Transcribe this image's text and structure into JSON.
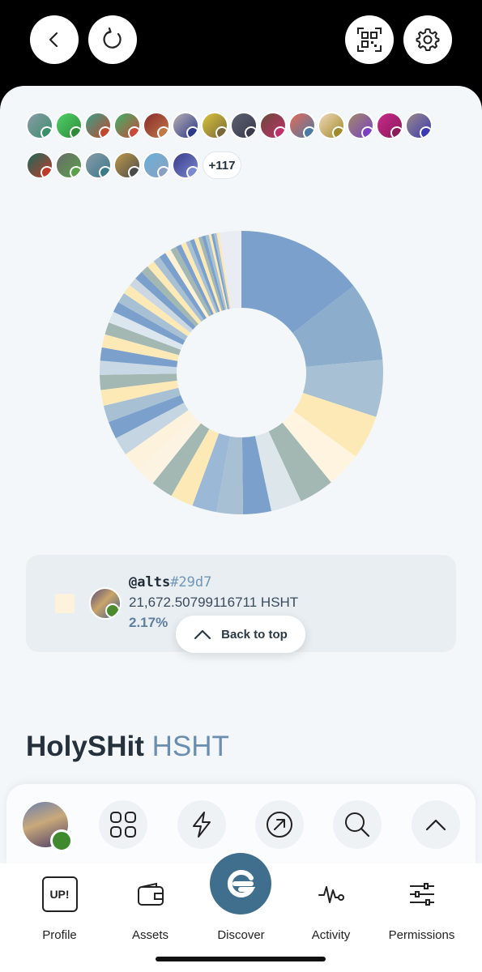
{
  "topbar": {
    "back_icon": "back-icon",
    "refresh_icon": "refresh-icon",
    "qr_icon": "qr-code-icon",
    "settings_icon": "gear-icon"
  },
  "holders": {
    "more_count": "+117"
  },
  "chart_data": {
    "type": "pie",
    "donut": true,
    "title": "",
    "values": [
      14.5,
      9.0,
      6.5,
      5.0,
      4.0,
      4.0,
      3.5,
      3.2,
      3.0,
      2.8,
      2.6,
      2.5,
      2.3,
      2.17,
      2.1,
      2.0,
      1.9,
      1.8,
      1.7,
      1.6,
      1.5,
      1.5,
      1.4,
      1.3,
      1.2,
      1.2,
      1.1,
      1.0,
      1.0,
      0.9,
      0.9,
      0.8,
      0.8,
      0.7,
      0.7,
      0.6,
      0.6,
      0.5,
      0.5,
      0.5,
      0.4,
      0.4,
      0.4,
      0.3,
      0.3,
      0.3,
      0.3,
      2.5
    ],
    "colors": [
      "#7aa0cb",
      "#8cadcb",
      "#a8c0d4",
      "#fde9b5",
      "#fff4e0",
      "#a3b8b3",
      "#dde6ea",
      "#7aa0cb",
      "#a8c0d4",
      "#9bb9d6",
      "#fde9b5",
      "#a3b8b3",
      "#fdf3e3",
      "#fdf3dd",
      "#c5d5e2",
      "#7aa0cb",
      "#a8c0d4",
      "#fde9b5",
      "#a3b8b3",
      "#c8d8e5",
      "#7aa0cb",
      "#fde9b5",
      "#a3b8b3",
      "#dce6ee",
      "#7aa0cb",
      "#a8c0d4",
      "#fde9b5",
      "#cbd8e3",
      "#7aa0cb",
      "#a3b8b3",
      "#fde9b5",
      "#a8c0d4",
      "#7aa0cb",
      "#fff1d6",
      "#a3b8b3",
      "#7aa0cb",
      "#fde9b5",
      "#a8c0d4",
      "#7aa0cb",
      "#fde9b5",
      "#a3b8b3",
      "#7aa0cb",
      "#a8c0d4",
      "#fde9b5",
      "#7aa0cb",
      "#a8c0d4",
      "#fde9b5",
      "#e9ecf2"
    ]
  },
  "selected_holder": {
    "username": "@alts",
    "hash": "#29d7",
    "amount": "21,672.50799116711 HSHT",
    "percent": "2.17%",
    "swatch_color": "#fdf3dd"
  },
  "back_to_top": {
    "label": "Back to top"
  },
  "token": {
    "name": "HolySHit",
    "symbol": "HSHT"
  },
  "dock": {
    "buttons": [
      "grid-icon",
      "lightning-icon",
      "arrow-up-right-icon",
      "search-icon",
      "chevron-up-icon"
    ]
  },
  "tabs": [
    {
      "label": "Profile",
      "icon": "up-badge-icon",
      "icon_text": "UP!"
    },
    {
      "label": "Assets",
      "icon": "wallet-icon"
    },
    {
      "label": "Discover",
      "icon": "discover-logo-icon"
    },
    {
      "label": "Activity",
      "icon": "activity-icon"
    },
    {
      "label": "Permissions",
      "icon": "sliders-icon"
    }
  ]
}
